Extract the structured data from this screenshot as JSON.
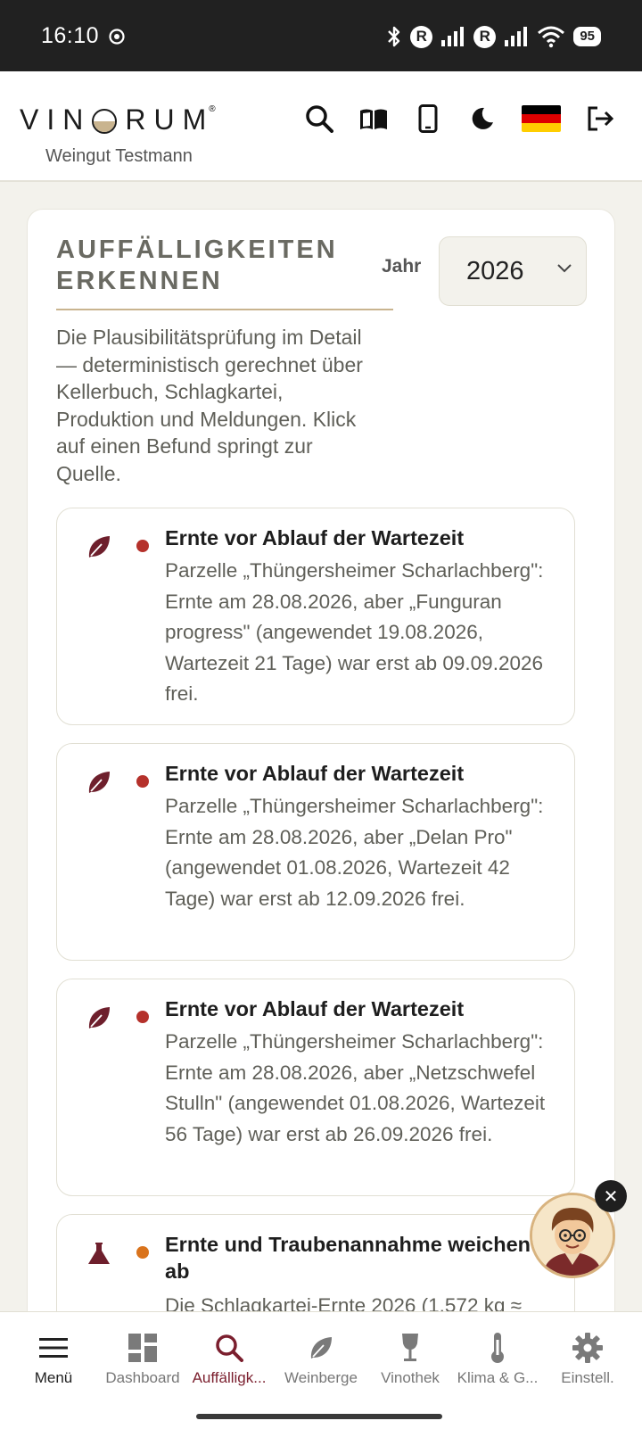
{
  "status_bar": {
    "time": "16:10",
    "battery": "95",
    "r1": "R",
    "r2": "R"
  },
  "header": {
    "logo": {
      "left": "VIN",
      "right": "RUM"
    },
    "winery_name": "Weingut Testmann"
  },
  "page": {
    "title_line1": "AUFFÄLLIGKEITEN",
    "title_line2": "ERKENNEN",
    "year_label": "Jahr",
    "year_value": "2026",
    "intro": "Die Plausibilitätsprüfung im Detail — deterministisch gerechnet über Kellerbuch, Schlagkartei, Produktion und Meldungen. Klick auf einen Befund springt zur Quelle."
  },
  "findings": [
    {
      "icon": "leaf-icon",
      "severity_color": "#b5312b",
      "title": "Ernte vor Ablauf der Wartezeit",
      "description": "Parzelle „Thüngersheimer Scharlachberg\": Ernte am 28.08.2026, aber „Funguran progress\" (angewendet 19.08.2026, Wartezeit 21 Tage) war erst ab 09.09.2026 frei."
    },
    {
      "icon": "leaf-icon",
      "severity_color": "#b5312b",
      "title": "Ernte vor Ablauf der Wartezeit",
      "description": "Parzelle „Thüngersheimer Scharlachberg\": Ernte am 28.08.2026, aber „Delan Pro\" (angewendet 01.08.2026, Wartezeit 42 Tage) war erst ab 12.09.2026 frei."
    },
    {
      "icon": "leaf-icon",
      "severity_color": "#b5312b",
      "title": "Ernte vor Ablauf der Wartezeit",
      "description": "Parzelle „Thüngersheimer Scharlachberg\": Ernte am 28.08.2026, aber „Netzschwefel Stulln\" (angewendet 01.08.2026, Wartezeit 56 Tage) war erst ab 26.09.2026 frei."
    },
    {
      "icon": "flask-icon",
      "severity_color": "#d9731c",
      "title": "Ernte und Traubenannahme weichen ab",
      "description": "Die Schlagkartei-Ernte 2026 (1.572 kg ≈"
    }
  ],
  "bottom_nav": [
    {
      "label": "Menü",
      "icon": "menu-icon"
    },
    {
      "label": "Dashboard",
      "icon": "dashboard-icon"
    },
    {
      "label": "Auffälligk...",
      "icon": "search-icon"
    },
    {
      "label": "Weinberge",
      "icon": "leaf-icon"
    },
    {
      "label": "Vinothek",
      "icon": "wine-glass-icon"
    },
    {
      "label": "Klima & G...",
      "icon": "thermometer-icon"
    },
    {
      "label": "Einstell.",
      "icon": "gear-icon"
    }
  ],
  "assistant": {
    "close_symbol": "✕"
  },
  "colors": {
    "accent": "#7b1f2e",
    "gold": "#c9b48f",
    "flag": [
      "#000000",
      "#dd0000",
      "#ffce00"
    ]
  }
}
